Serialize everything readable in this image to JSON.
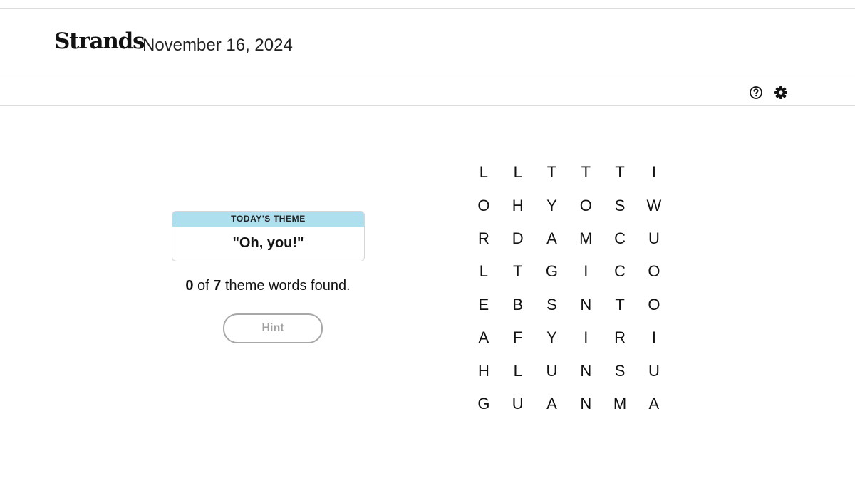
{
  "header": {
    "brand": "Strands",
    "date": "November 16, 2024"
  },
  "toolbar": {
    "help_icon": "help-circle-icon",
    "settings_icon": "gear-icon"
  },
  "theme": {
    "label": "TODAY'S THEME",
    "text": "\"Oh, you!\""
  },
  "progress": {
    "found": "0",
    "of_text": " of ",
    "total": "7",
    "suffix": " theme words found."
  },
  "hint": {
    "label": "Hint"
  },
  "grid": {
    "rows": [
      [
        "L",
        "L",
        "T",
        "T",
        "T",
        "I"
      ],
      [
        "O",
        "H",
        "Y",
        "O",
        "S",
        "W"
      ],
      [
        "R",
        "D",
        "A",
        "M",
        "C",
        "U"
      ],
      [
        "L",
        "T",
        "G",
        "I",
        "C",
        "O"
      ],
      [
        "E",
        "B",
        "S",
        "N",
        "T",
        "O"
      ],
      [
        "A",
        "F",
        "Y",
        "I",
        "R",
        "I"
      ],
      [
        "H",
        "L",
        "U",
        "N",
        "S",
        "U"
      ],
      [
        "G",
        "U",
        "A",
        "N",
        "M",
        "A"
      ]
    ]
  },
  "colors": {
    "theme_label_bg": "#aedfee",
    "text": "#121212",
    "hint_border": "#a7a7a7"
  }
}
